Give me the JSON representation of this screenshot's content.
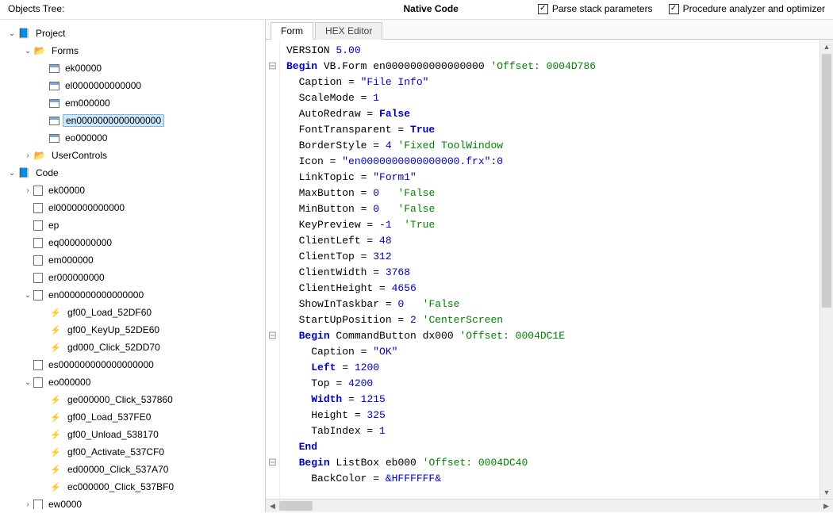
{
  "top": {
    "objects_label": "Objects Tree:",
    "heading": "Native Code",
    "cb1_label": "Parse stack parameters",
    "cb1_checked": true,
    "cb2_label": "Procedure analyzer and optimizer",
    "cb2_checked": true
  },
  "tree": [
    {
      "depth": 0,
      "tw": "open",
      "icon": "project",
      "label": "Project"
    },
    {
      "depth": 1,
      "tw": "open",
      "icon": "folder",
      "label": "Forms"
    },
    {
      "depth": 2,
      "tw": "",
      "icon": "form",
      "label": "ek00000"
    },
    {
      "depth": 2,
      "tw": "",
      "icon": "form",
      "label": "el0000000000000"
    },
    {
      "depth": 2,
      "tw": "",
      "icon": "form",
      "label": "em000000"
    },
    {
      "depth": 2,
      "tw": "",
      "icon": "form",
      "label": "en0000000000000000",
      "selected": true
    },
    {
      "depth": 2,
      "tw": "",
      "icon": "form",
      "label": "eo000000"
    },
    {
      "depth": 1,
      "tw": "closed",
      "icon": "folder",
      "label": "UserControls"
    },
    {
      "depth": 0,
      "tw": "open",
      "icon": "project",
      "label": "Code"
    },
    {
      "depth": 1,
      "tw": "closed",
      "icon": "code",
      "label": "ek00000"
    },
    {
      "depth": 1,
      "tw": "",
      "icon": "code",
      "label": "el0000000000000"
    },
    {
      "depth": 1,
      "tw": "",
      "icon": "code",
      "label": "ep"
    },
    {
      "depth": 1,
      "tw": "",
      "icon": "code",
      "label": "eq0000000000"
    },
    {
      "depth": 1,
      "tw": "",
      "icon": "code",
      "label": "em000000"
    },
    {
      "depth": 1,
      "tw": "",
      "icon": "code",
      "label": "er000000000"
    },
    {
      "depth": 1,
      "tw": "open",
      "icon": "code",
      "label": "en0000000000000000"
    },
    {
      "depth": 2,
      "tw": "",
      "icon": "bolt",
      "label": "gf00_Load_52DF60"
    },
    {
      "depth": 2,
      "tw": "",
      "icon": "bolt",
      "label": "gf00_KeyUp_52DE60"
    },
    {
      "depth": 2,
      "tw": "",
      "icon": "bolt",
      "label": "gd000_Click_52DD70"
    },
    {
      "depth": 1,
      "tw": "",
      "icon": "code",
      "label": "es000000000000000000"
    },
    {
      "depth": 1,
      "tw": "open",
      "icon": "code",
      "label": "eo000000"
    },
    {
      "depth": 2,
      "tw": "",
      "icon": "bolt",
      "label": "ge000000_Click_537860"
    },
    {
      "depth": 2,
      "tw": "",
      "icon": "bolt",
      "label": "gf00_Load_537FE0"
    },
    {
      "depth": 2,
      "tw": "",
      "icon": "bolt",
      "label": "gf00_Unload_538170"
    },
    {
      "depth": 2,
      "tw": "",
      "icon": "bolt",
      "label": "gf00_Activate_537CF0"
    },
    {
      "depth": 2,
      "tw": "",
      "icon": "bolt",
      "label": "ed00000_Click_537A70"
    },
    {
      "depth": 2,
      "tw": "",
      "icon": "bolt",
      "label": "ec000000_Click_537BF0"
    },
    {
      "depth": 1,
      "tw": "closed",
      "icon": "code",
      "label": "ew0000"
    }
  ],
  "tabs": {
    "form": "Form",
    "hex": "HEX Editor"
  },
  "code_lines": [
    {
      "g": "",
      "segs": [
        {
          "t": "VERSION ",
          "c": ""
        },
        {
          "t": "5.00",
          "c": "num"
        }
      ]
    },
    {
      "g": "⊟",
      "segs": [
        {
          "t": "Begin",
          "c": "kw"
        },
        {
          "t": " VB.Form en0000000000000000 ",
          "c": ""
        },
        {
          "t": "'Offset: 0004D786",
          "c": "cmt"
        }
      ]
    },
    {
      "g": "",
      "segs": [
        {
          "t": "  Caption = ",
          "c": ""
        },
        {
          "t": "\"File Info\"",
          "c": "str"
        }
      ]
    },
    {
      "g": "",
      "segs": [
        {
          "t": "  ScaleMode = ",
          "c": ""
        },
        {
          "t": "1",
          "c": "num"
        }
      ]
    },
    {
      "g": "",
      "segs": [
        {
          "t": "  AutoRedraw = ",
          "c": ""
        },
        {
          "t": "False",
          "c": "kw2"
        }
      ]
    },
    {
      "g": "",
      "segs": [
        {
          "t": "  FontTransparent = ",
          "c": ""
        },
        {
          "t": "True",
          "c": "kw2"
        }
      ]
    },
    {
      "g": "",
      "segs": [
        {
          "t": "  BorderStyle = ",
          "c": ""
        },
        {
          "t": "4",
          "c": "num"
        },
        {
          "t": " ",
          "c": ""
        },
        {
          "t": "'Fixed ToolWindow",
          "c": "cmt"
        }
      ]
    },
    {
      "g": "",
      "segs": [
        {
          "t": "  Icon = ",
          "c": ""
        },
        {
          "t": "\"en0000000000000000.frx\"",
          "c": "str"
        },
        {
          "t": ":",
          "c": ""
        },
        {
          "t": "0",
          "c": "num"
        }
      ]
    },
    {
      "g": "",
      "segs": [
        {
          "t": "  LinkTopic = ",
          "c": ""
        },
        {
          "t": "\"Form1\"",
          "c": "str"
        }
      ]
    },
    {
      "g": "",
      "segs": [
        {
          "t": "  MaxButton = ",
          "c": ""
        },
        {
          "t": "0",
          "c": "num"
        },
        {
          "t": "   ",
          "c": ""
        },
        {
          "t": "'False",
          "c": "cmt"
        }
      ]
    },
    {
      "g": "",
      "segs": [
        {
          "t": "  MinButton = ",
          "c": ""
        },
        {
          "t": "0",
          "c": "num"
        },
        {
          "t": "   ",
          "c": ""
        },
        {
          "t": "'False",
          "c": "cmt"
        }
      ]
    },
    {
      "g": "",
      "segs": [
        {
          "t": "  KeyPreview = ",
          "c": ""
        },
        {
          "t": "-1",
          "c": "num"
        },
        {
          "t": "  ",
          "c": ""
        },
        {
          "t": "'True",
          "c": "cmt"
        }
      ]
    },
    {
      "g": "",
      "segs": [
        {
          "t": "  ClientLeft = ",
          "c": ""
        },
        {
          "t": "48",
          "c": "num"
        }
      ]
    },
    {
      "g": "",
      "segs": [
        {
          "t": "  ClientTop = ",
          "c": ""
        },
        {
          "t": "312",
          "c": "num"
        }
      ]
    },
    {
      "g": "",
      "segs": [
        {
          "t": "  ClientWidth = ",
          "c": ""
        },
        {
          "t": "3768",
          "c": "num"
        }
      ]
    },
    {
      "g": "",
      "segs": [
        {
          "t": "  ClientHeight = ",
          "c": ""
        },
        {
          "t": "4656",
          "c": "num"
        }
      ]
    },
    {
      "g": "",
      "segs": [
        {
          "t": "  ShowInTaskbar = ",
          "c": ""
        },
        {
          "t": "0",
          "c": "num"
        },
        {
          "t": "   ",
          "c": ""
        },
        {
          "t": "'False",
          "c": "cmt"
        }
      ]
    },
    {
      "g": "",
      "segs": [
        {
          "t": "  StartUpPosition = ",
          "c": ""
        },
        {
          "t": "2",
          "c": "num"
        },
        {
          "t": " ",
          "c": ""
        },
        {
          "t": "'CenterScreen",
          "c": "cmt"
        }
      ]
    },
    {
      "g": "⊟",
      "segs": [
        {
          "t": "  ",
          "c": ""
        },
        {
          "t": "Begin",
          "c": "kw"
        },
        {
          "t": " CommandButton dx000 ",
          "c": ""
        },
        {
          "t": "'Offset: 0004DC1E",
          "c": "cmt"
        }
      ]
    },
    {
      "g": "",
      "segs": [
        {
          "t": "    Caption = ",
          "c": ""
        },
        {
          "t": "\"OK\"",
          "c": "str"
        }
      ]
    },
    {
      "g": "",
      "segs": [
        {
          "t": "    ",
          "c": ""
        },
        {
          "t": "Left",
          "c": "kw"
        },
        {
          "t": " = ",
          "c": ""
        },
        {
          "t": "1200",
          "c": "num"
        }
      ]
    },
    {
      "g": "",
      "segs": [
        {
          "t": "    Top = ",
          "c": ""
        },
        {
          "t": "4200",
          "c": "num"
        }
      ]
    },
    {
      "g": "",
      "segs": [
        {
          "t": "    ",
          "c": ""
        },
        {
          "t": "Width",
          "c": "kw"
        },
        {
          "t": " = ",
          "c": ""
        },
        {
          "t": "1215",
          "c": "num"
        }
      ]
    },
    {
      "g": "",
      "segs": [
        {
          "t": "    Height = ",
          "c": ""
        },
        {
          "t": "325",
          "c": "num"
        }
      ]
    },
    {
      "g": "",
      "segs": [
        {
          "t": "    TabIndex = ",
          "c": ""
        },
        {
          "t": "1",
          "c": "num"
        }
      ]
    },
    {
      "g": "",
      "segs": [
        {
          "t": "  ",
          "c": ""
        },
        {
          "t": "End",
          "c": "kw"
        }
      ]
    },
    {
      "g": "⊟",
      "segs": [
        {
          "t": "  ",
          "c": ""
        },
        {
          "t": "Begin",
          "c": "kw"
        },
        {
          "t": " ListBox eb000 ",
          "c": ""
        },
        {
          "t": "'Offset: 0004DC40",
          "c": "cmt"
        }
      ]
    },
    {
      "g": "",
      "segs": [
        {
          "t": "    BackColor = ",
          "c": ""
        },
        {
          "t": "&HFFFFFF&",
          "c": "num"
        }
      ]
    }
  ]
}
